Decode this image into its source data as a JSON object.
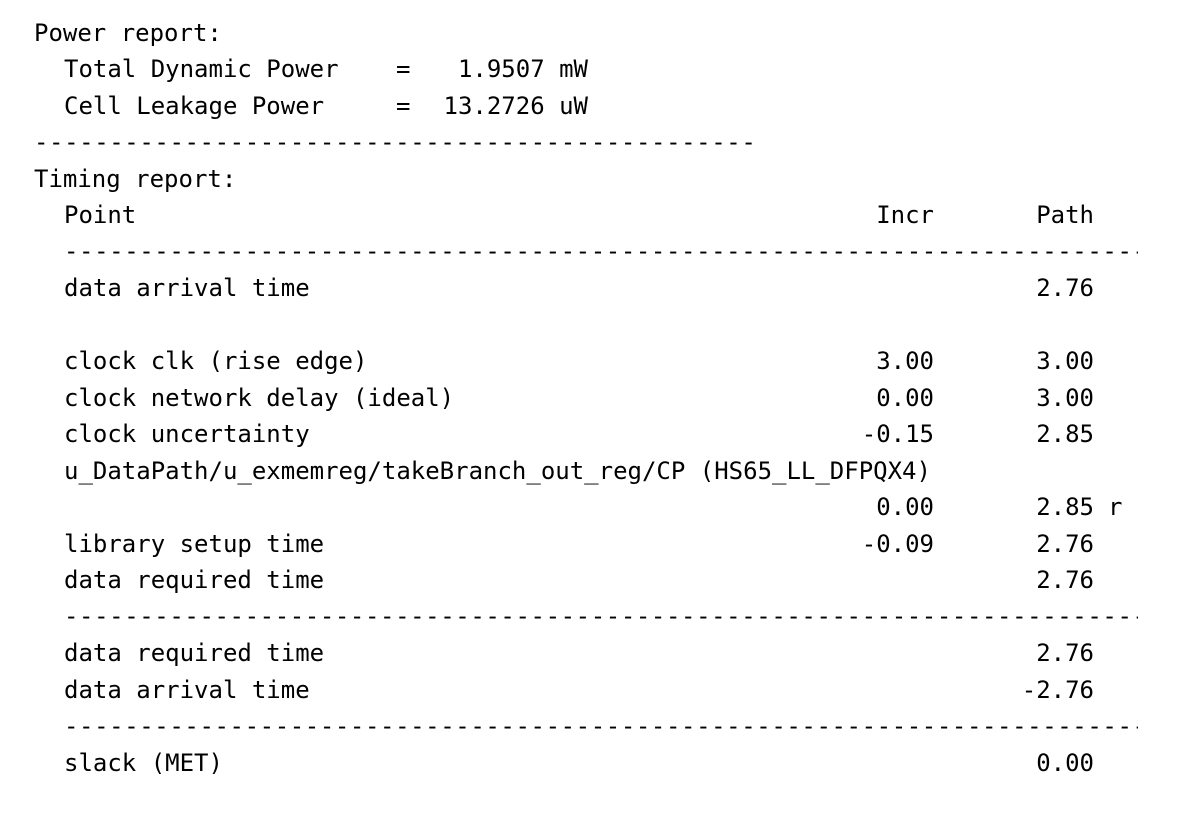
{
  "power": {
    "heading": "Power report:",
    "dynamic_label": "Total Dynamic Power",
    "dynamic_eq": "=",
    "dynamic_value": "1.9507 mW",
    "leakage_label": "Cell Leakage Power",
    "leakage_eq": "=",
    "leakage_value": "13.2726 uW",
    "separator": "--------------------------------------------------"
  },
  "timing": {
    "heading": "Timing report:",
    "col_point": "Point",
    "col_incr": "Incr",
    "col_path": "Path",
    "separator": "-----------------------------------------------------------------------------------",
    "rows": [
      {
        "point": "data arrival time",
        "incr": "",
        "path": "2.76"
      },
      {
        "point": "clock clk (rise edge)",
        "incr": "3.00",
        "path": "3.00"
      },
      {
        "point": "clock network delay (ideal)",
        "incr": "0.00",
        "path": "3.00"
      },
      {
        "point": "clock uncertainty",
        "incr": "-0.15",
        "path": "2.85"
      },
      {
        "point": "u_DataPath/u_exmemreg/takeBranch_out_reg/CP (HS65_LL_DFPQX4)",
        "incr": "",
        "path": ""
      },
      {
        "point": "",
        "incr": "0.00",
        "path": "2.85",
        "flag": "r"
      },
      {
        "point": "library setup time",
        "incr": "-0.09",
        "path": "2.76"
      },
      {
        "point": "data required time",
        "incr": "",
        "path": "2.76"
      },
      {
        "point": "data required time",
        "incr": "",
        "path": "2.76"
      },
      {
        "point": "data arrival time",
        "incr": "",
        "path": "-2.76"
      },
      {
        "point": "slack (MET)",
        "incr": "",
        "path": "0.00"
      }
    ]
  }
}
